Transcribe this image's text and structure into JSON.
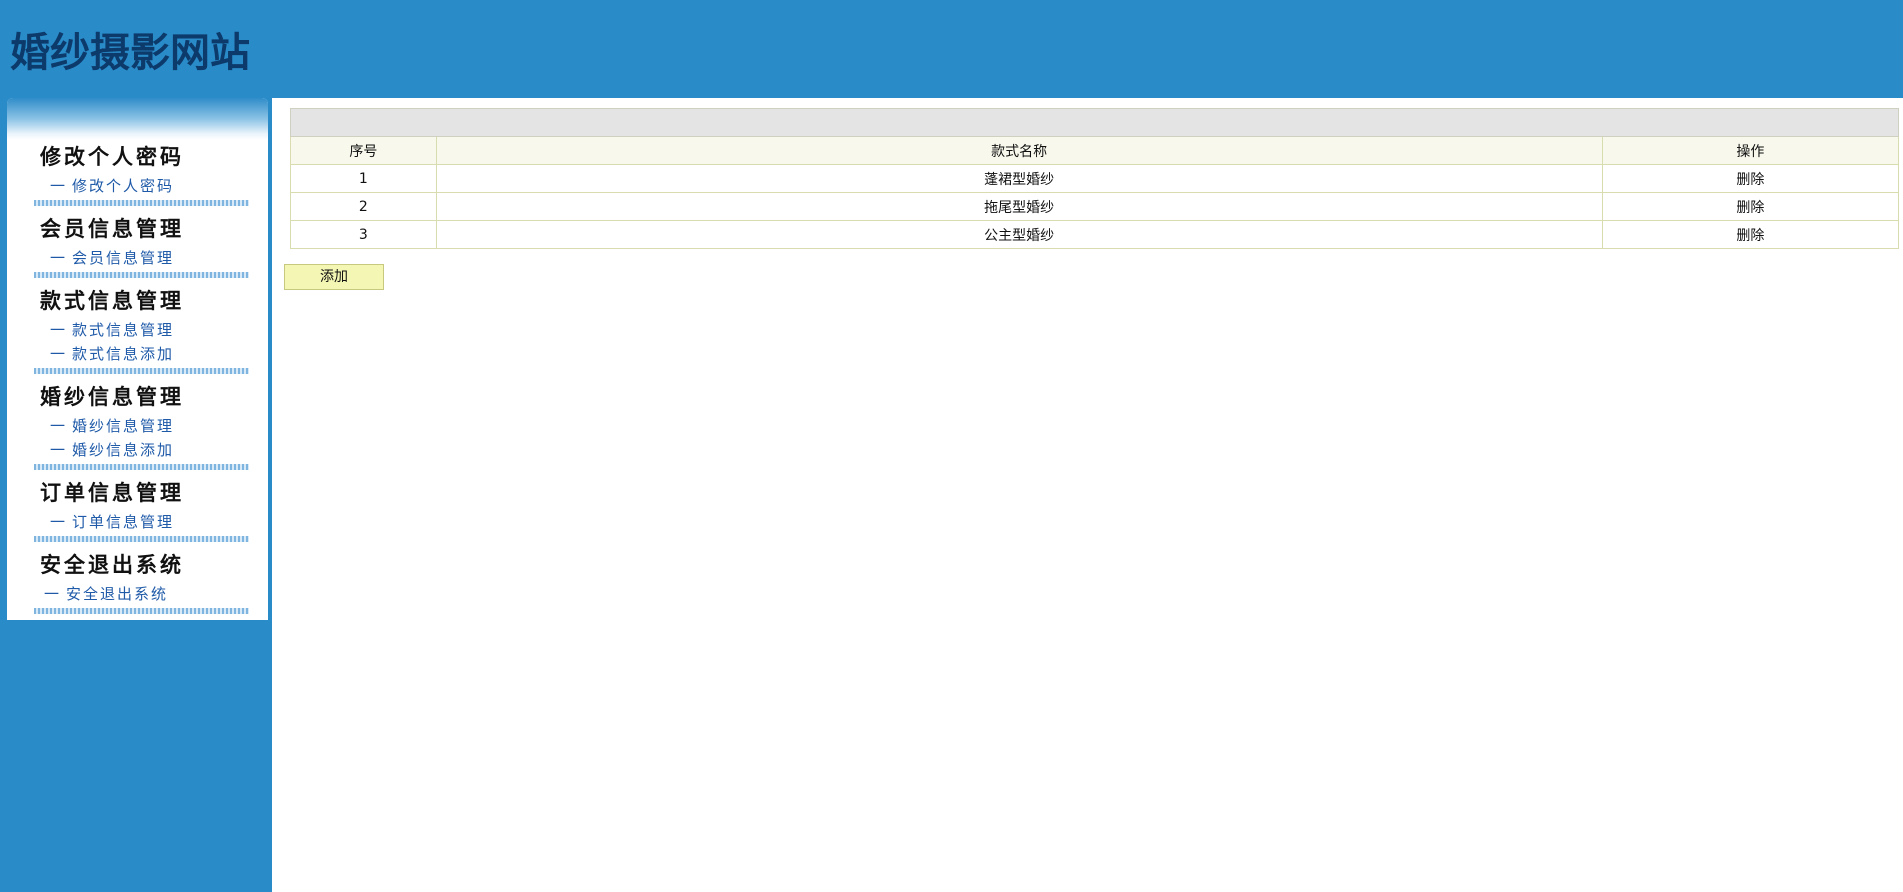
{
  "header": {
    "site_title": "婚纱摄影网站"
  },
  "sidebar": {
    "groups": [
      {
        "title": "修改个人密码",
        "links": [
          "修改个人密码"
        ]
      },
      {
        "title": "会员信息管理",
        "links": [
          "会员信息管理"
        ]
      },
      {
        "title": "款式信息管理",
        "links": [
          "款式信息管理",
          "款式信息添加"
        ]
      },
      {
        "title": "婚纱信息管理",
        "links": [
          "婚纱信息管理",
          "婚纱信息添加"
        ]
      },
      {
        "title": "订单信息管理",
        "links": [
          "订单信息管理"
        ]
      },
      {
        "title": "安全退出系统",
        "links": [
          "安全退出系统"
        ]
      }
    ],
    "dash": "一"
  },
  "table": {
    "headers": [
      "序号",
      "款式名称",
      "操作"
    ],
    "rows": [
      {
        "no": "1",
        "name": "蓬裙型婚纱",
        "op": "删除"
      },
      {
        "no": "2",
        "name": "拖尾型婚纱",
        "op": "删除"
      },
      {
        "no": "3",
        "name": "公主型婚纱",
        "op": "删除"
      }
    ]
  },
  "add_button": "添加",
  "colors": {
    "brand_blue": "#2a8bc9",
    "title_navy": "#0c3a6b",
    "link_blue": "#1f5aa8",
    "button_yellow": "#f4f7b3"
  }
}
